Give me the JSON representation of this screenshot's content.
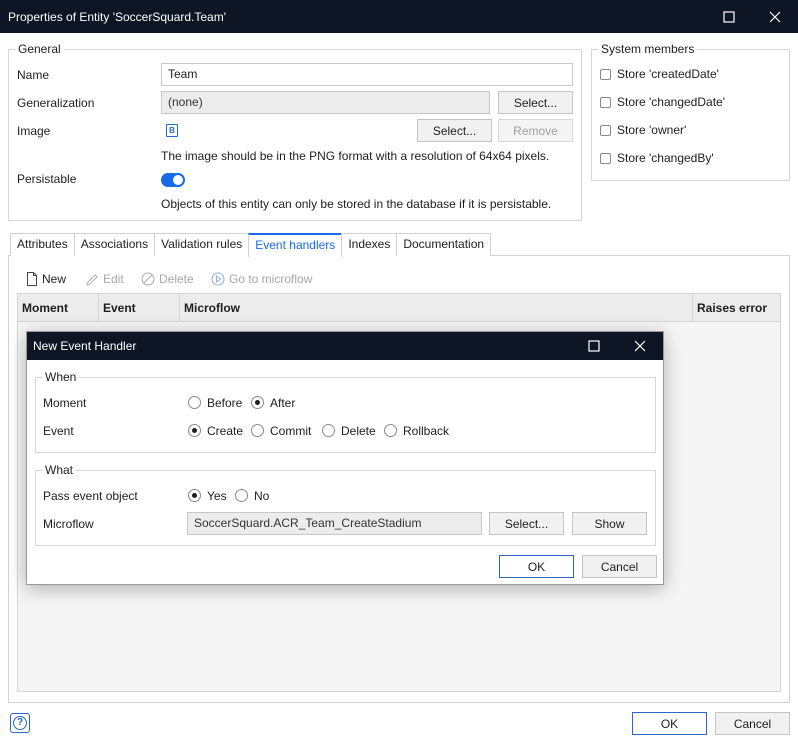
{
  "window": {
    "title": "Properties of Entity 'SoccerSquard.Team'"
  },
  "general": {
    "legend": "General",
    "name_label": "Name",
    "name_value": "Team",
    "generalization_label": "Generalization",
    "generalization_value": "(none)",
    "generalization_select": "Select...",
    "image_label": "Image",
    "image_select": "Select...",
    "image_remove": "Remove",
    "image_hint": "The image should be in the PNG format with a resolution of 64x64 pixels.",
    "persistable_label": "Persistable",
    "persistable_hint": "Objects of this entity can only be stored in the database if it is persistable."
  },
  "system_members": {
    "legend": "System members",
    "items": [
      "Store 'createdDate'",
      "Store 'changedDate'",
      "Store 'owner'",
      "Store 'changedBy'"
    ]
  },
  "tabs": [
    "Attributes",
    "Associations",
    "Validation rules",
    "Event handlers",
    "Indexes",
    "Documentation"
  ],
  "toolbar": {
    "new": "New",
    "edit": "Edit",
    "delete": "Delete",
    "goto": "Go to microflow"
  },
  "grid": {
    "columns": [
      "Moment",
      "Event",
      "Microflow",
      "Raises error"
    ]
  },
  "dialog": {
    "title": "New Event Handler",
    "when_legend": "When",
    "moment_label": "Moment",
    "moment_options": [
      "Before",
      "After"
    ],
    "event_label": "Event",
    "event_options": [
      "Create",
      "Commit",
      "Delete",
      "Rollback"
    ],
    "what_legend": "What",
    "pass_label": "Pass event object",
    "pass_options": [
      "Yes",
      "No"
    ],
    "microflow_label": "Microflow",
    "microflow_value": "SoccerSquard.ACR_Team_CreateStadium",
    "select_button": "Select...",
    "show_button": "Show",
    "ok_button": "OK",
    "cancel_button": "Cancel"
  },
  "footer": {
    "help": "?",
    "ok_button": "OK",
    "cancel_button": "Cancel"
  },
  "colors": {
    "titlebar": "#0e1525",
    "accent": "#1a6ae6"
  }
}
